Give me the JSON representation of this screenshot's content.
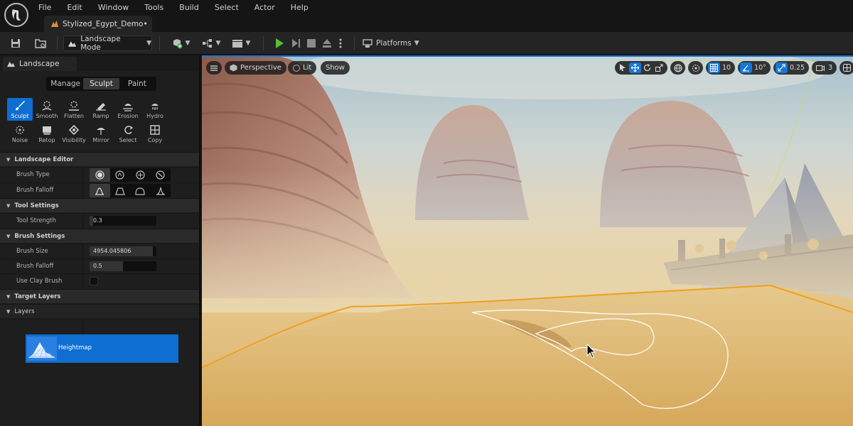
{
  "menu": {
    "items": [
      "File",
      "Edit",
      "Window",
      "Tools",
      "Build",
      "Select",
      "Actor",
      "Help"
    ],
    "level_tab": "Stylized_Egypt_Demo•"
  },
  "toolbar": {
    "mode_label": "Landscape Mode",
    "platforms_label": "Platforms"
  },
  "panel": {
    "tab_label": "Landscape",
    "modes": [
      "Manage",
      "Sculpt",
      "Paint"
    ],
    "active_mode": "Sculpt",
    "tools": [
      {
        "label": "Sculpt",
        "icon": "brush-icon",
        "active": true
      },
      {
        "label": "Smooth",
        "icon": "smooth-icon"
      },
      {
        "label": "Flatten",
        "icon": "flatten-icon"
      },
      {
        "label": "Ramp",
        "icon": "ramp-icon"
      },
      {
        "label": "Erosion",
        "icon": "erosion-icon"
      },
      {
        "label": "Hydro",
        "icon": "hydro-icon"
      },
      {
        "label": "Noise",
        "icon": "noise-icon"
      },
      {
        "label": "Retop",
        "icon": "retopologize-icon"
      },
      {
        "label": "Visibility",
        "icon": "visibility-icon"
      },
      {
        "label": "Mirror",
        "icon": "mirror-icon"
      },
      {
        "label": "Select",
        "icon": "select-icon"
      },
      {
        "label": "Copy",
        "icon": "copy-icon"
      }
    ],
    "sections": {
      "landscape_editor": "Landscape Editor",
      "tool_settings": "Tool Settings",
      "brush_settings": "Brush Settings",
      "target_layers": "Target Layers",
      "layers": "Layers"
    },
    "props": {
      "brush_type": "Brush Type",
      "brush_falloff_type": "Brush Falloff",
      "tool_strength": "Tool Strength",
      "tool_strength_value": "0.3",
      "tool_strength_fraction": 0.05,
      "brush_size": "Brush Size",
      "brush_size_value": "4954.045806",
      "brush_size_fraction": 0.95,
      "brush_falloff": "Brush Falloff",
      "brush_falloff_value": "0.5",
      "brush_falloff_fraction": 0.5,
      "use_clay_brush": "Use Clay Brush",
      "use_clay_brush_checked": false
    },
    "layer_name": "Heightmap"
  },
  "viewport": {
    "view_mode": "Perspective",
    "lighting": "Lit",
    "show": "Show",
    "grid_snap": "10",
    "rotation_snap": "10°",
    "scale_snap": "0.25",
    "camera_speed": "3"
  },
  "colors": {
    "accent": "#0f6ed1",
    "selection_outline": "#f0a020"
  }
}
